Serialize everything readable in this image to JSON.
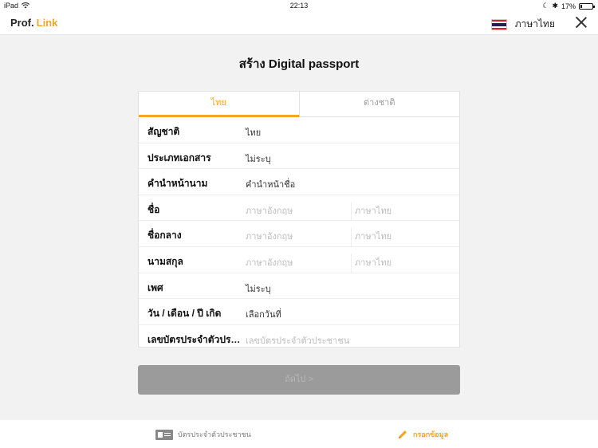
{
  "status_bar": {
    "device": "iPad",
    "time": "22:13",
    "battery": "17%",
    "battery_level": 0.17
  },
  "header": {
    "brand_part1": "Prof.",
    "brand_part2": "Link",
    "language_label": "ภาษาไทย"
  },
  "page": {
    "title": "สร้าง Digital passport"
  },
  "tabs": [
    {
      "label": "ไทย",
      "active": true
    },
    {
      "label": "ต่างชาติ",
      "active": false
    }
  ],
  "form_rows": [
    {
      "label": "สัญชาติ",
      "value": "ไทย"
    },
    {
      "label": "ประเภทเอกสาร",
      "value": "ไม่ระบุ"
    },
    {
      "label": "คำนำหน้านาม",
      "value": "คำนำหน้าชื่อ"
    },
    {
      "label": "ชื่อ",
      "placeholder_en": "ภาษาอังกฤษ",
      "placeholder_th": "ภาษาไทย"
    },
    {
      "label": "ชื่อกลาง",
      "placeholder_en": "ภาษาอังกฤษ",
      "placeholder_th": "ภาษาไทย"
    },
    {
      "label": "นามสกุล",
      "placeholder_en": "ภาษาอังกฤษ",
      "placeholder_th": "ภาษาไทย"
    },
    {
      "label": "เพศ",
      "value": "ไม่ระบุ"
    },
    {
      "label": "วัน / เดือน / ปี เกิด",
      "value": "เลือกวันที่"
    },
    {
      "label": "เลขบัตรประจำตัวประชาชน",
      "placeholder": "เลขบัตรประจำตัวประชาชน"
    }
  ],
  "next_button": {
    "label": "ถัดไป >"
  },
  "bottom_bar": [
    {
      "label": "บัตรประจำตัวประชาชน",
      "icon": "id-card-icon"
    },
    {
      "label": "กรอกข้อมูล",
      "icon": "pencil-icon",
      "active": true
    }
  ],
  "colors": {
    "accent": "#f5a623",
    "disabled_button": "#9b9b9b"
  }
}
